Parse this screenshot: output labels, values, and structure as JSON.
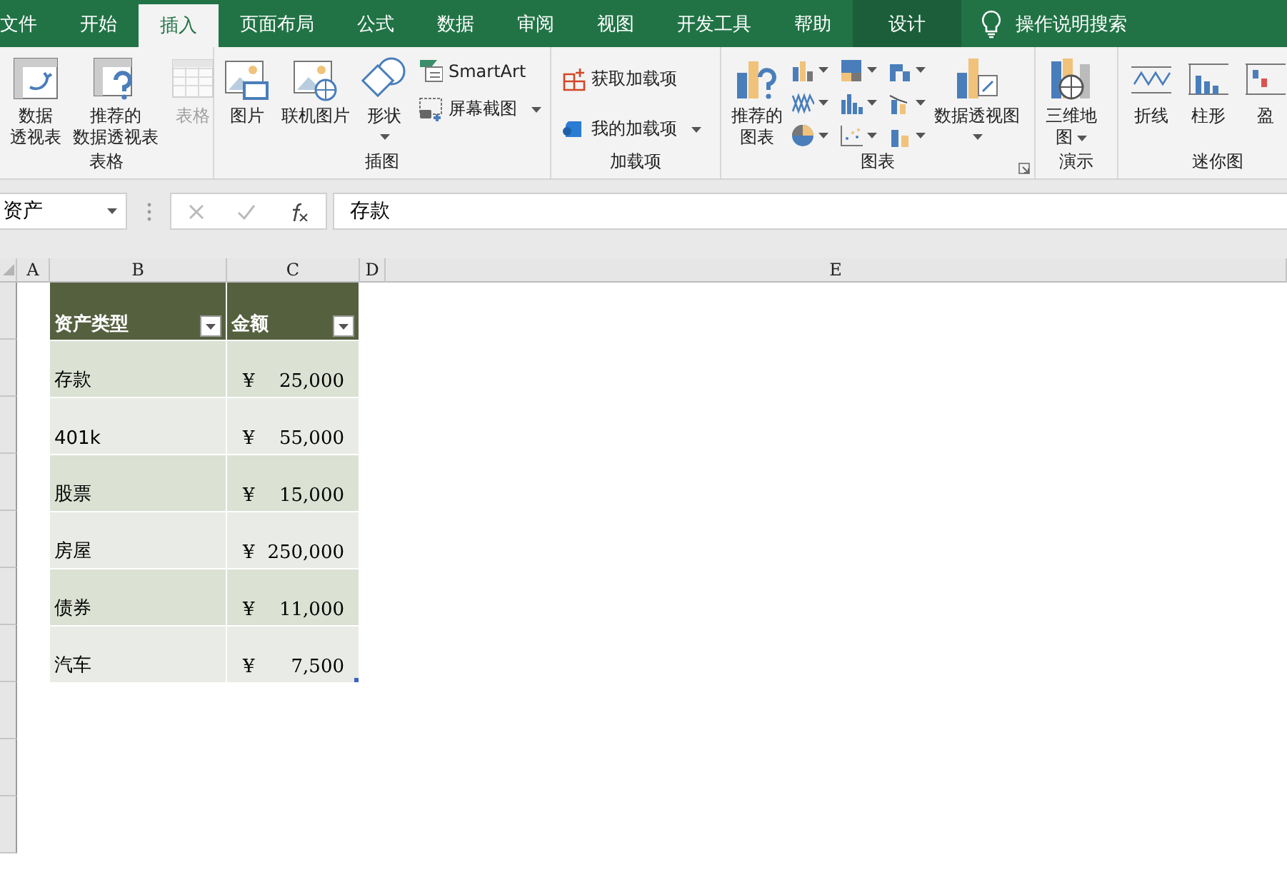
{
  "tabs": [
    {
      "label": "文件",
      "selected": false,
      "kind": "normal"
    },
    {
      "label": "开始",
      "selected": false,
      "kind": "normal"
    },
    {
      "label": "插入",
      "selected": true,
      "kind": "normal"
    },
    {
      "label": "页面布局",
      "selected": false,
      "kind": "normal"
    },
    {
      "label": "公式",
      "selected": false,
      "kind": "normal"
    },
    {
      "label": "数据",
      "selected": false,
      "kind": "normal"
    },
    {
      "label": "审阅",
      "selected": false,
      "kind": "normal"
    },
    {
      "label": "视图",
      "selected": false,
      "kind": "normal"
    },
    {
      "label": "开发工具",
      "selected": false,
      "kind": "normal"
    },
    {
      "label": "帮助",
      "selected": false,
      "kind": "normal"
    },
    {
      "label": "设计",
      "selected": false,
      "kind": "context"
    }
  ],
  "tell_me": {
    "label": "操作说明搜索"
  },
  "ribbon_groups": [
    {
      "label": "表格",
      "items": [
        {
          "kind": "large",
          "lines": [
            "数据",
            "透视表"
          ],
          "dropdown": false,
          "disabled": false
        },
        {
          "kind": "large",
          "lines": [
            "推荐的",
            "数据透视表"
          ],
          "dropdown": false,
          "disabled": false
        },
        {
          "kind": "large",
          "lines": [
            "表格"
          ],
          "dropdown": false,
          "disabled": true
        }
      ]
    },
    {
      "label": "插图",
      "items": [
        {
          "kind": "large",
          "lines": [
            "图片"
          ],
          "dropdown": false,
          "disabled": false
        },
        {
          "kind": "large",
          "lines": [
            "联机图片"
          ],
          "dropdown": false,
          "disabled": false
        },
        {
          "kind": "large",
          "lines": [
            "形状"
          ],
          "dropdown": true,
          "disabled": false
        },
        {
          "kind": "stack",
          "entries": [
            {
              "label": "SmartArt",
              "dropdown": false
            },
            {
              "label": "屏幕截图",
              "dropdown": true
            }
          ]
        }
      ]
    },
    {
      "label": "加载项",
      "items": [
        {
          "kind": "stack",
          "entries": [
            {
              "label": "获取加载项",
              "dropdown": false
            },
            {
              "label": "我的加载项",
              "dropdown": true
            }
          ]
        }
      ]
    },
    {
      "label": "图表",
      "launcher": true,
      "items": [
        {
          "kind": "large",
          "lines": [
            "推荐的",
            "图表"
          ],
          "dropdown": false,
          "disabled": false
        },
        {
          "kind": "grid"
        },
        {
          "kind": "large",
          "lines": [
            "数据透视图"
          ],
          "dropdown": true,
          "disabled": false
        }
      ]
    },
    {
      "label": "演示",
      "items": [
        {
          "kind": "large",
          "lines": [
            "三维地",
            "图"
          ],
          "dropdown": true,
          "disabled": false
        }
      ]
    },
    {
      "label": "迷你图",
      "items": [
        {
          "kind": "large",
          "lines": [
            "折线"
          ],
          "dropdown": false,
          "disabled": false
        },
        {
          "kind": "large",
          "lines": [
            "柱形"
          ],
          "dropdown": false,
          "disabled": false
        },
        {
          "kind": "large",
          "lines": [
            "盈"
          ],
          "dropdown": false,
          "disabled": false
        }
      ]
    }
  ],
  "formula_bar": {
    "name_box": "资产",
    "value": "存款"
  },
  "sheet": {
    "columns": [
      "A",
      "B",
      "C",
      "D",
      "E"
    ],
    "table": {
      "headers": [
        "资产类型",
        "金额"
      ],
      "rows": [
        {
          "type": "存款",
          "currency": "¥",
          "amount": "25,000"
        },
        {
          "type": "401k",
          "currency": "¥",
          "amount": "55,000"
        },
        {
          "type": "股票",
          "currency": "¥",
          "amount": "15,000"
        },
        {
          "type": "房屋",
          "currency": "¥",
          "amount": "250,000"
        },
        {
          "type": "债券",
          "currency": "¥",
          "amount": "11,000"
        },
        {
          "type": "汽车",
          "currency": "¥",
          "amount": "7,500"
        }
      ]
    }
  }
}
